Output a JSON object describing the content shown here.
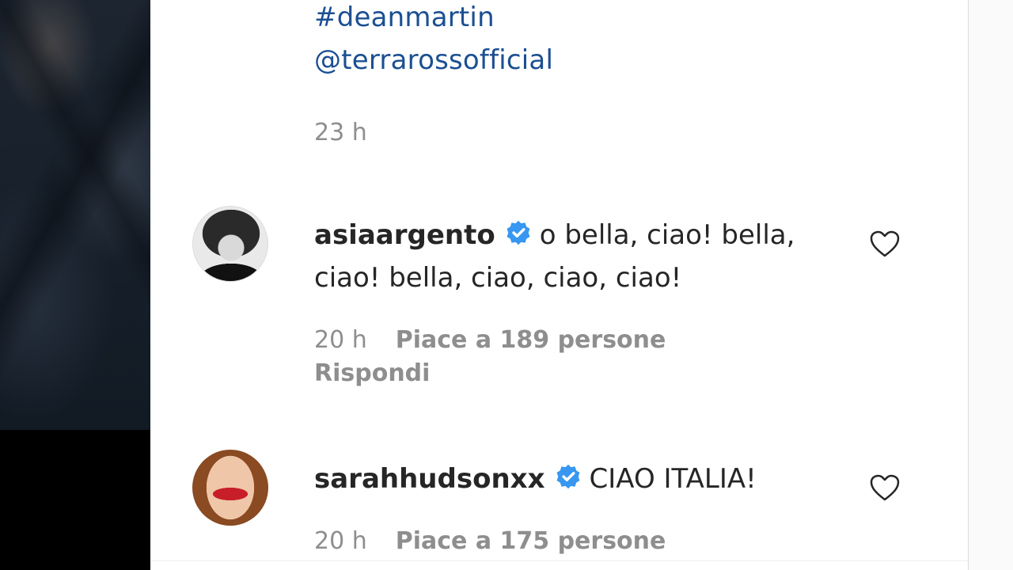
{
  "caption": {
    "hashtag": "#deanmartin",
    "mention": "@terrarossofficial",
    "time": "23 h"
  },
  "comments": [
    {
      "username": "asiaargento",
      "verified": true,
      "text": "o bella, ciao! bella, ciao! bella, ciao, ciao, ciao!",
      "time": "20 h",
      "likes": "Piace a 189 persone",
      "reply": "Rispondi"
    },
    {
      "username": "sarahhudsonxx",
      "verified": true,
      "text": "CIAO ITALIA!",
      "time": "20 h",
      "likes": "Piace a 175 persone"
    }
  ],
  "icons": {
    "verified": "verified-badge-icon",
    "like": "heart-icon"
  },
  "colors": {
    "link": "#1b4f92",
    "verified": "#3897f0",
    "muted": "#8e8e8e",
    "text": "#262626"
  }
}
